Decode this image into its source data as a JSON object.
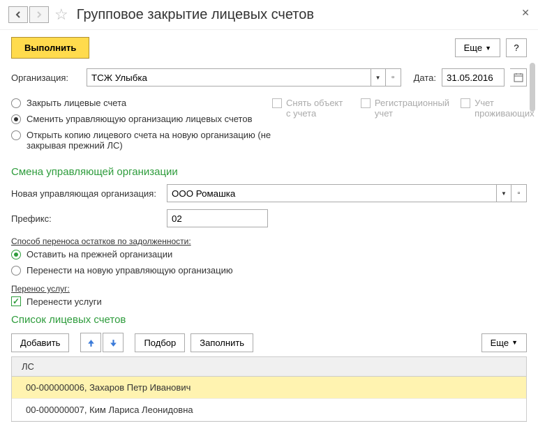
{
  "header": {
    "title": "Групповое закрытие лицевых счетов"
  },
  "toolbar": {
    "execute": "Выполнить",
    "more": "Еще",
    "help": "?"
  },
  "org": {
    "label": "Организация:",
    "value": "ТСЖ Улыбка",
    "date_label": "Дата:",
    "date_value": "31.05.2016"
  },
  "radios": {
    "r1": "Закрыть лицевые счета",
    "r2": "Сменить управляющую организацию лицевых счетов",
    "r3": "Открыть копию лицевого счета на новую организацию (не закрывая прежний ЛС)"
  },
  "checks": {
    "c1": "Снять объект с учета",
    "c2": "Регистрационный учет",
    "c3": "Учет проживающих"
  },
  "section1": {
    "title": "Смена управляющей организации",
    "new_org_label": "Новая управляющая организация:",
    "new_org_value": "ООО Ромашка",
    "prefix_label": "Префикс:",
    "prefix_value": "02",
    "transfer_title": "Способ переноса остатков по задолженности:",
    "opt1": "Оставить на прежней организации",
    "opt2": "Перенести на новую управляющую организацию",
    "services_title": "Перенос услуг:",
    "services_cb": "Перенести услуги"
  },
  "section2": {
    "title": "Список лицевых счетов",
    "add": "Добавить",
    "pick": "Подбор",
    "fill": "Заполнить",
    "more": "Еще",
    "col_header": "ЛС",
    "rows": [
      "00-000000006, Захаров Петр Иванович",
      "00-000000007, Ким Лариса Леонидовна"
    ]
  }
}
